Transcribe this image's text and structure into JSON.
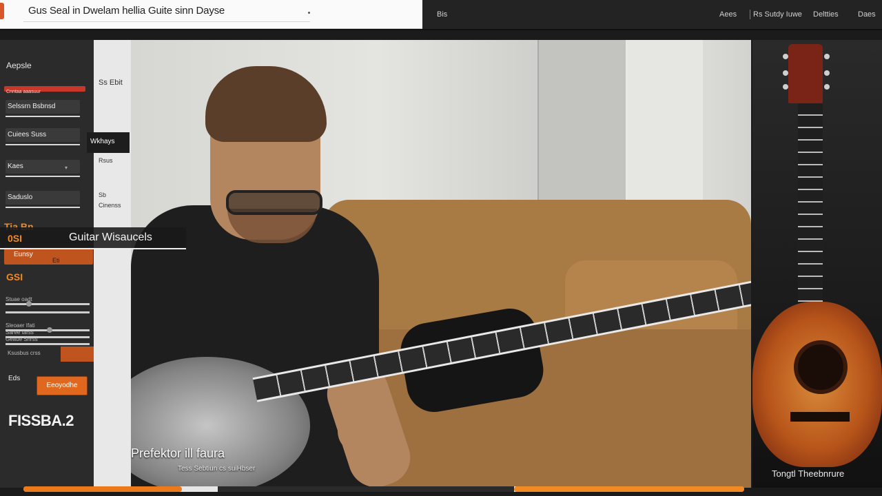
{
  "header": {
    "title": "Gus Seal in Dwelam hellia Guite sinn Dayse",
    "nav": [
      "Bis",
      "Aees",
      "Rs Sutdy Iuwe",
      "Deltties",
      "Daes"
    ]
  },
  "sidebar": {
    "heading": "Aepsle",
    "red_label": "Cnntaa aaasuur",
    "fields": [
      {
        "label": "Selssrn Bsbnsd"
      },
      {
        "label": "Cuiees Suss"
      },
      {
        "label": "Kaes"
      },
      {
        "label": "Saduslo"
      }
    ],
    "orange_value": "Tia Bn",
    "orange_bar_label": "Eunsy",
    "orange_bar_badge": "Eti",
    "stat_value": "GSI",
    "sliders": [
      "Stuae oadt",
      "Sleoaer Ifati",
      "Saree tarss",
      "Geaue Shrss"
    ],
    "status": "Ksusbus crss",
    "small_label": "Eds",
    "button_label": "Eeoyodhe",
    "big_label": "FISSBA.2"
  },
  "subcol": {
    "items": [
      "Ss Ebit",
      "Rsus",
      "Sb",
      "Cinenss"
    ],
    "tooltip": "Wkhays"
  },
  "hero": {
    "label_num": "0SI",
    "label_text": "Guitar Wisaucels",
    "caption": "Prefektor ill faura",
    "caption_sub": "Tess Sebtiun cs suiHbser"
  },
  "right_panel": {
    "caption": "Tongtl Theebnrure"
  },
  "progress": {
    "value": 0.22
  },
  "colors": {
    "accent": "#ec7a1c",
    "alert": "#c8382a",
    "dark": "#232323"
  }
}
